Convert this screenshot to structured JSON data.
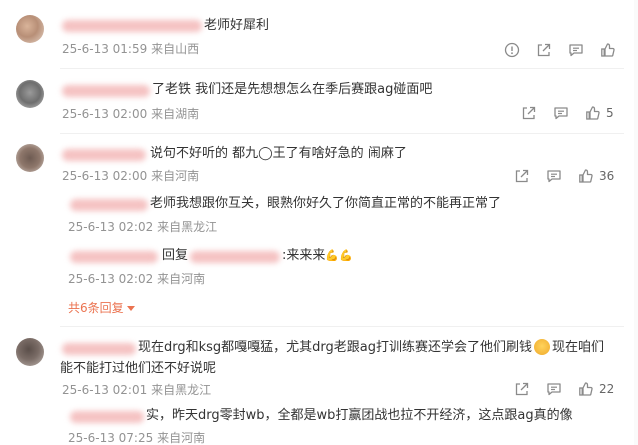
{
  "comments": [
    {
      "text": "老师好犀利",
      "time": "25-6-13 01:59",
      "location": "来自山西"
    },
    {
      "text": "了老铁 我们还是先想想怎么在季后赛跟ag碰面吧",
      "time": "25-6-13 02:00",
      "location": "来自湖南",
      "likes": "5"
    },
    {
      "text": "说句不好听的  都九◯王了有啥好急的 闹麻了",
      "time": "25-6-13 02:00",
      "location": "来自河南",
      "likes": "36",
      "replies": [
        {
          "text": "老师我想跟你互关，眼熟你好久了你简直正常的不能再正常了",
          "time": "25-6-13 02:02",
          "location": "来自黑龙江"
        },
        {
          "prefix": "回复",
          "text": ":来来来",
          "emoji": "💪💪",
          "time": "25-6-13 02:02",
          "location": "来自河南"
        }
      ],
      "expand_label": "共6条回复"
    },
    {
      "text_line1": "现在drg和ksg都嘎嘎猛，尤其drg老跟ag打训练赛还学会了他们刷钱",
      "text_line1b": "现在咱们",
      "text_line2": "能不能打过他们还不好说呢",
      "time": "25-6-13 02:01",
      "location": "来自黑龙江",
      "likes": "22",
      "replies": [
        {
          "text": "实，昨天drg零封wb，全都是wb打赢团战也拉不开经济，这点跟ag真的像",
          "time": "25-6-13 07:25",
          "location": "来自河南"
        }
      ]
    }
  ],
  "colors": {
    "meta": "#939393",
    "accent": "#eb7350",
    "text": "#333333"
  }
}
